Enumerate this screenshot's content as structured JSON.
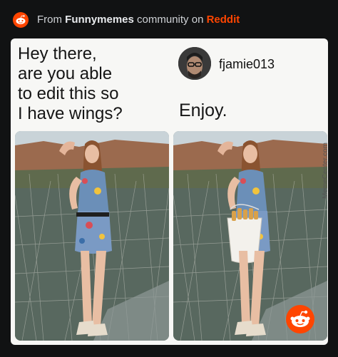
{
  "header": {
    "prefix": "From ",
    "community": "Funnymemes",
    "middle": " community on ",
    "platform": "Reddit"
  },
  "meme": {
    "question": "Hey there,\nare you able\nto edit this so\nI have wings?",
    "username": "fjamie013",
    "reply": "Enjoy.",
    "watermark": "MemeCenter.com"
  }
}
